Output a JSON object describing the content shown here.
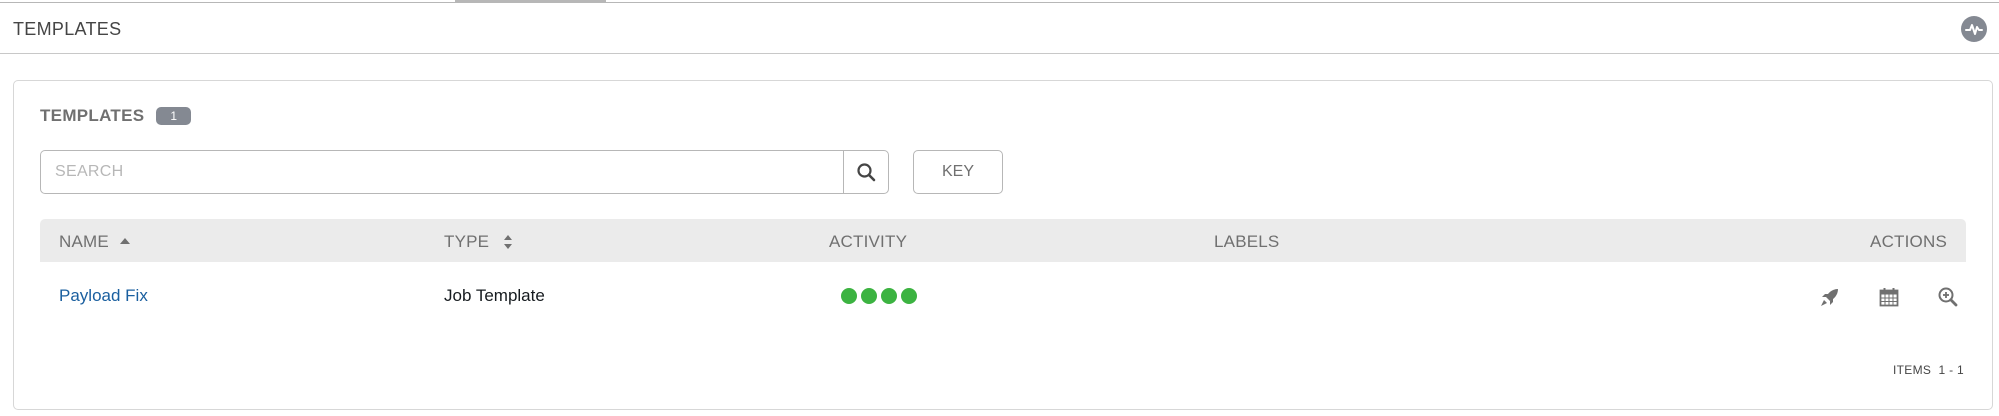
{
  "breadcrumb": {
    "title": "TEMPLATES"
  },
  "panel": {
    "title": "TEMPLATES",
    "count": "1"
  },
  "search": {
    "placeholder": "SEARCH",
    "value": ""
  },
  "key_button": {
    "label": "KEY"
  },
  "columns": {
    "name": "NAME",
    "type": "TYPE",
    "activity": "ACTIVITY",
    "labels": "LABELS",
    "actions": "ACTIONS"
  },
  "rows": [
    {
      "name": "Payload Fix",
      "type": "Job Template",
      "activity": [
        "success",
        "success",
        "success",
        "success"
      ],
      "labels": ""
    }
  ],
  "pagination": {
    "label": "ITEMS  1 - 1"
  },
  "icons": {
    "activity_stream": "activity-stream-icon",
    "search": "search-icon",
    "launch": "rocket-icon",
    "schedule": "calendar-icon",
    "copy": "zoom-in-icon"
  },
  "colors": {
    "link": "#1a5f9f",
    "success": "#3cb341",
    "badge": "#848992",
    "header_bg": "#ebebeb"
  }
}
